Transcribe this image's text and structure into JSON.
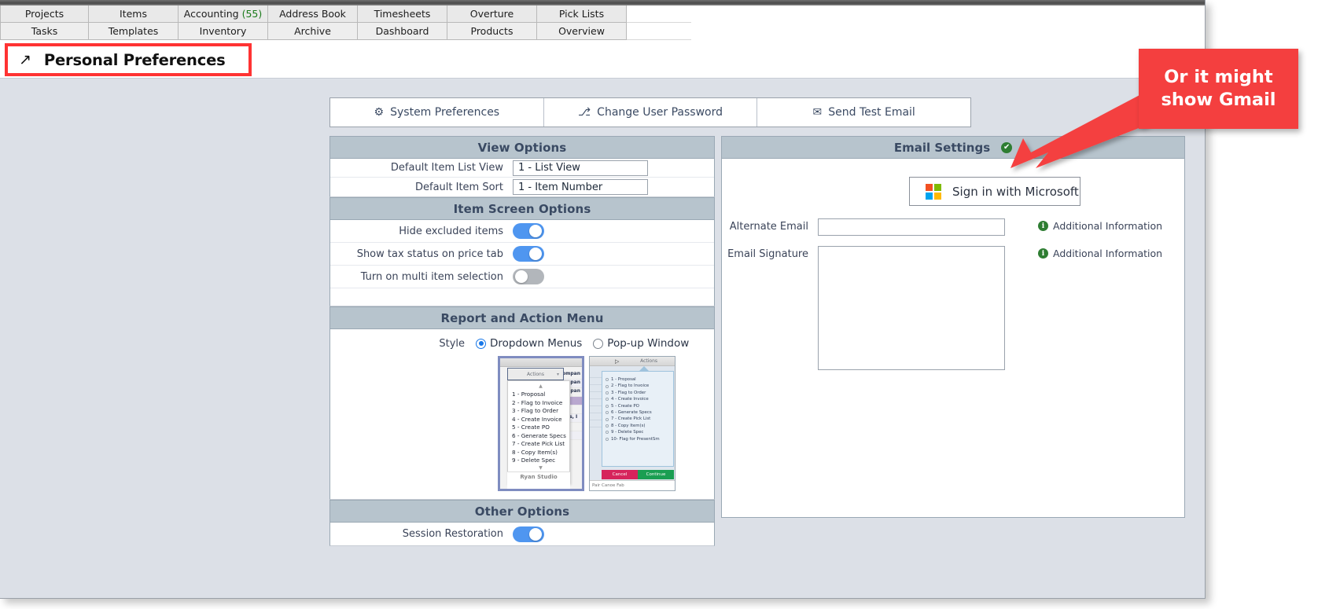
{
  "nav": {
    "row1": [
      {
        "label": "Projects",
        "count": null
      },
      {
        "label": "Items",
        "count": null
      },
      {
        "label": "Accounting",
        "count": "(55)"
      },
      {
        "label": "Address Book",
        "count": null
      },
      {
        "label": "Timesheets",
        "count": null
      },
      {
        "label": "Overture",
        "count": null
      },
      {
        "label": "Pick Lists",
        "count": null
      }
    ],
    "row2": [
      {
        "label": "Tasks"
      },
      {
        "label": "Templates"
      },
      {
        "label": "Inventory"
      },
      {
        "label": "Archive"
      },
      {
        "label": "Dashboard"
      },
      {
        "label": "Products"
      },
      {
        "label": "Overview"
      }
    ]
  },
  "header": {
    "title": "Personal Preferences",
    "external_icon": "↗"
  },
  "toolbar": {
    "buttons": [
      {
        "label": "System Preferences",
        "icon": "⚙"
      },
      {
        "label": "Change User Password",
        "icon": "⎇"
      },
      {
        "label": "Send Test Email",
        "icon": "✉"
      }
    ]
  },
  "view_options": {
    "title": "View Options",
    "fields": [
      {
        "label": "Default Item List View",
        "value": "1 - List View"
      },
      {
        "label": "Default Item Sort",
        "value": "1 - Item Number"
      }
    ]
  },
  "item_screen_options": {
    "title": "Item Screen Options",
    "toggles": [
      {
        "label": "Hide excluded items",
        "on": true
      },
      {
        "label": "Show tax status on price tab",
        "on": true
      },
      {
        "label": "Turn on multi item selection",
        "on": false
      }
    ]
  },
  "report_action_menu": {
    "title": "Report and Action Menu",
    "style_label": "Style",
    "options": [
      {
        "label": "Dropdown Menus",
        "selected": true
      },
      {
        "label": "Pop-up Window",
        "selected": false
      }
    ],
    "dropdown_preview": {
      "button_label": "Actions",
      "items": [
        "1 - Proposal",
        "2 - Flag to Invoice",
        "3 - Flag to Order",
        "4 - Create Invoice",
        "5 - Create PO",
        "6 - Generate Specs",
        "7 - Create Pick List",
        "8 - Copy Item(s)",
        "9 - Delete Spec"
      ],
      "bg_rows": [
        "ompan",
        "ompan",
        "ompan",
        "",
        "",
        "ries, I",
        "",
        ""
      ],
      "footer": "Ryan Studio"
    },
    "popup_preview": {
      "header_label": "Actions",
      "items": [
        "1 - Proposal",
        "2 - Flag to Invoice",
        "3 - Flag to Order",
        "4 - Create Invoice",
        "5 - Create PO",
        "6 - Generate Specs",
        "7 - Create Pick List",
        "8 - Copy Item(s)",
        "9 - Delete Spec",
        "10- Flag for PresentSm"
      ],
      "cancel_label": "Cancel",
      "continue_label": "Continue",
      "footer": "Pair       Canoe Fab"
    }
  },
  "other_options": {
    "title": "Other Options",
    "toggles": [
      {
        "label": "Session Restoration",
        "on": true
      }
    ]
  },
  "email_settings": {
    "title": "Email Settings",
    "status_icon": "✔",
    "sign_in_label": "Sign in with Microsoft",
    "fields": [
      {
        "label": "Alternate Email",
        "value": "",
        "info": "Additional Information"
      },
      {
        "label": "Email Signature",
        "value": "",
        "info": "Additional Information"
      }
    ]
  },
  "annotation": {
    "line1": "Or it might",
    "line2": "show Gmail",
    "color": "#f43f3f"
  },
  "colors": {
    "accent": "#4f96f0",
    "section_header": "#b7c4cd",
    "header_text": "#3a4a63",
    "page_bg": "#dce0e7",
    "annotation_red": "#f43f3f",
    "success_green": "#2e7d32"
  }
}
